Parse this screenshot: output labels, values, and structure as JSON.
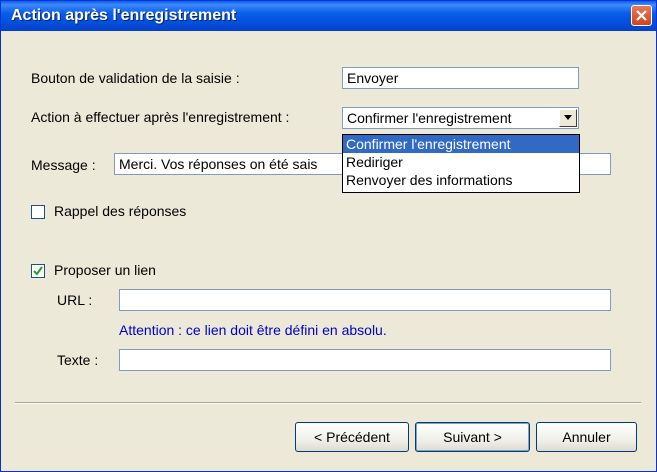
{
  "window": {
    "title": "Action après l'enregistrement"
  },
  "labels": {
    "validation": "Bouton de validation de la saisie :",
    "action": "Action à effectuer après l'enregistrement :",
    "message": "Message :",
    "recall": "Rappel des réponses",
    "propose_link": "Proposer un lien",
    "url": "URL :",
    "text": "Texte :",
    "note": "Attention : ce lien doit être défini en absolu."
  },
  "fields": {
    "validation_value": "Envoyer",
    "action_value": "Confirmer l'enregistrement",
    "message_value": "Merci. Vos réponses on été sais",
    "url_value": "",
    "text_value": ""
  },
  "dropdown": {
    "options": [
      "Confirmer l'enregistrement",
      "Rediriger",
      "Renvoyer des informations"
    ],
    "selected_index": 0
  },
  "checkboxes": {
    "recall_checked": false,
    "propose_link_checked": true
  },
  "buttons": {
    "previous_label": "< Précédent",
    "next_label": "Suivant >",
    "cancel_label": "Annuler"
  }
}
